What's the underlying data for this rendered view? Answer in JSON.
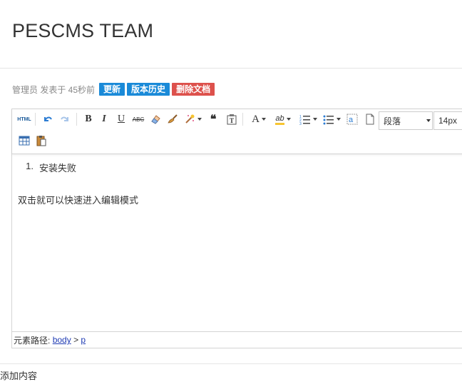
{
  "page": {
    "title": "PESCMS TEAM"
  },
  "meta": {
    "author_text": "管理员 发表于 45秒前",
    "actions": [
      {
        "label": "更新",
        "color": "#1a8ad8"
      },
      {
        "label": "版本历史",
        "color": "#1a8ad8"
      },
      {
        "label": "删除文档",
        "color": "#dd514c"
      }
    ]
  },
  "editor": {
    "toolbar": {
      "html_label": "HTML",
      "bold_label": "B",
      "italic_label": "I",
      "underline_label": "U",
      "strike_label": "ABC",
      "quote_label": "❝",
      "forecolor_label": "A",
      "highlight_label": "ab",
      "paragraph_select": "段落",
      "fontsize_select": "14px"
    },
    "content": {
      "list_items": [
        "安装失败"
      ],
      "list_index": "1.",
      "paragraph": "双击就可以快速进入编辑模式"
    },
    "statusbar": {
      "label": "元素路径:",
      "path_body": "body",
      "separator": ">",
      "path_p": "p"
    }
  },
  "bottom_label": "添加内容"
}
